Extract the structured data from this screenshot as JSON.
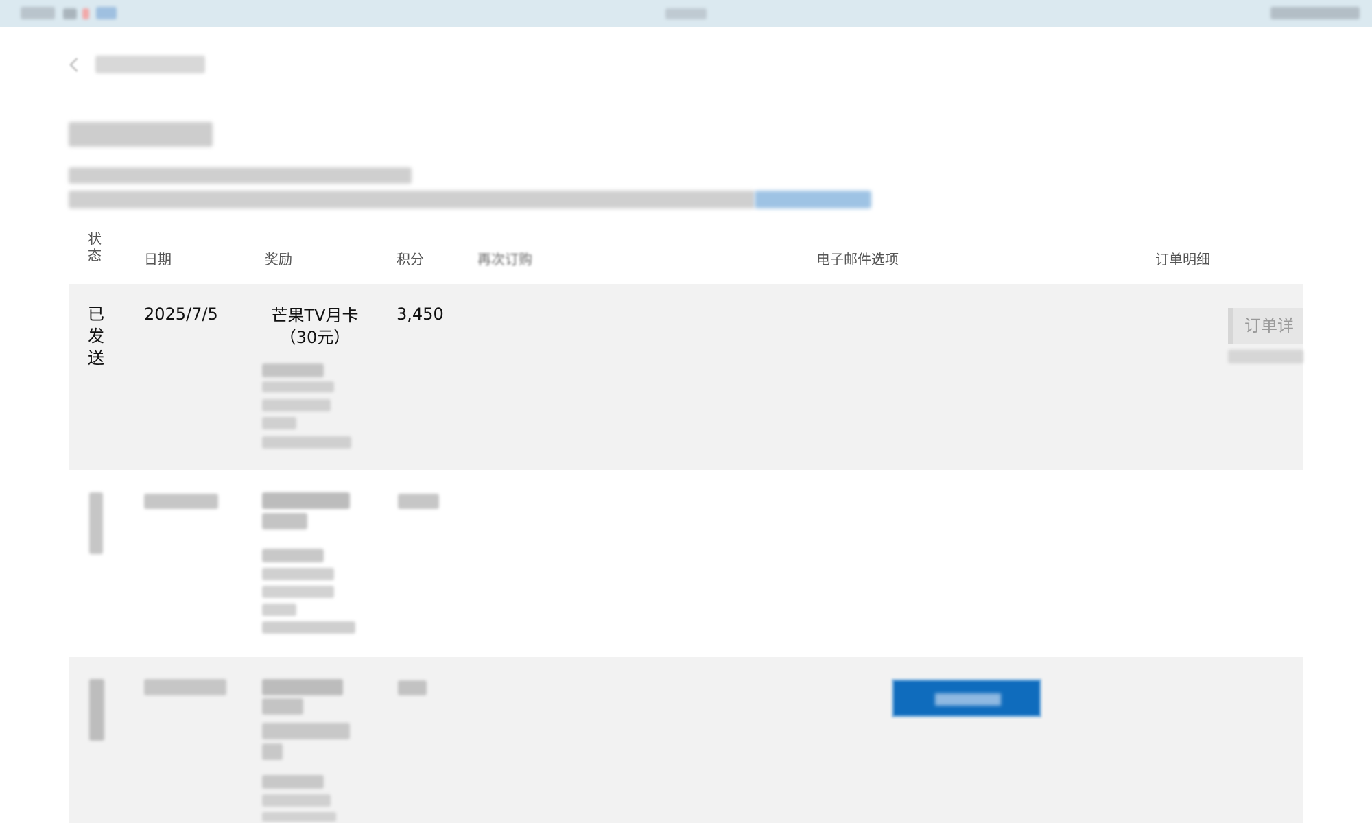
{
  "table": {
    "headers": {
      "status": "状态",
      "date": "日期",
      "reward": "奖励",
      "points": "积分",
      "reorder": "再次订购",
      "email_options": "电子邮件选项",
      "order_details": "订单明细"
    },
    "rows": [
      {
        "status": "已发送",
        "date": "2025/7/5",
        "reward": "芒果TV月卡（30元）",
        "points": "3,450",
        "order_details_button": "订单详"
      }
    ]
  },
  "colors": {
    "topbar": "#dbe9f0",
    "row_shaded": "#f2f2f2",
    "primary_button": "#0f6cbd"
  },
  "icons": {
    "back": "chevron-left-icon"
  }
}
